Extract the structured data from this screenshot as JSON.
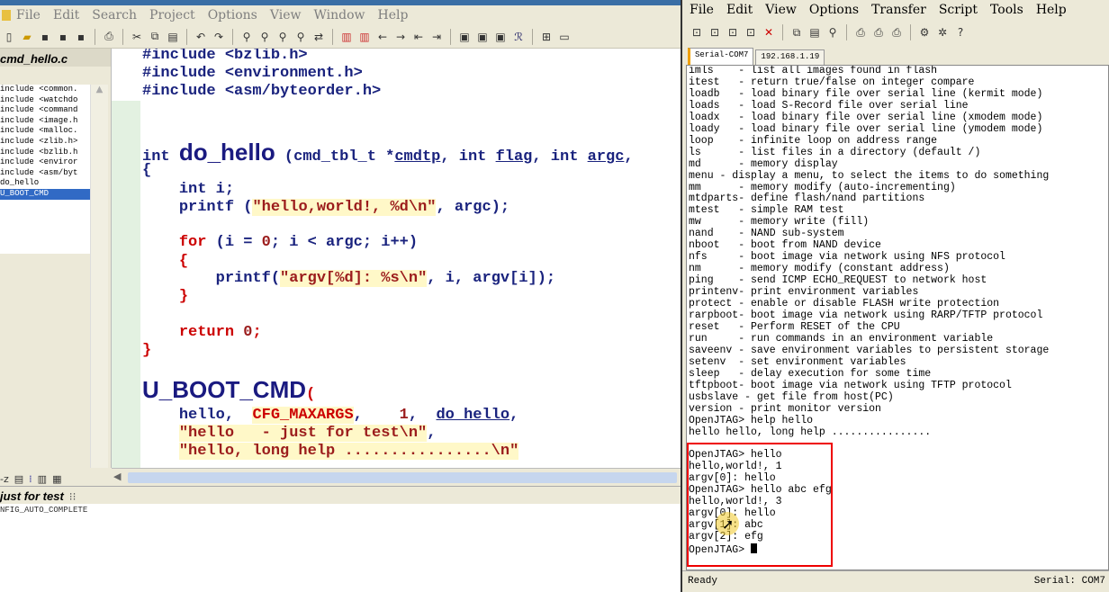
{
  "source_insight": {
    "menu": [
      {
        "label": "File"
      },
      {
        "label": "Edit"
      },
      {
        "label": "Search"
      },
      {
        "label": "Project"
      },
      {
        "label": "Options"
      },
      {
        "label": "View"
      },
      {
        "label": "Window"
      },
      {
        "label": "Help"
      }
    ],
    "file_name": "cmd_hello.c",
    "symbols": [
      "include <common.",
      "include <watchdo",
      "include <command",
      "include <image.h",
      "include <malloc.",
      "include <zlib.h>",
      "include <bzlib.h",
      "include <enviror",
      "include <asm/byt",
      "do_hello",
      "U_BOOT_CMD"
    ],
    "selected_symbol": "U_BOOT_CMD",
    "context_title": "just for test",
    "context_sub": "NFIG_AUTO_COMPLETE",
    "code": {
      "l1": "#include <bzlib.h>",
      "l2": "#include <environment.h>",
      "l3": "#include <asm/byteorder.h>",
      "fn_type": "int",
      "fn_name": "do_hello",
      "fn_params_a": "(cmd_tbl_t *",
      "fn_p1": "cmdtp",
      "fn_params_b": ", int ",
      "fn_p2": "flag",
      "fn_params_c": ", int ",
      "fn_p3": "argc",
      "fn_params_d": ",",
      "open_brace": "{",
      "decl": "int i;",
      "printf1_a": "printf (",
      "printf1_str": "\"hello,world!, %d\\n\"",
      "printf1_b": ", argc);",
      "for_kw": "for",
      "for_rest_a": " (i = ",
      "for_zero": "0",
      "for_rest_b": "; i < argc; i++)",
      "inner_open": "{",
      "printf2_a": "printf(",
      "printf2_str": "\"argv[%d]: %s\\n\"",
      "printf2_b": ", i, argv[i]);",
      "inner_close": "}",
      "return_kw": "return",
      "return_val": "0",
      "return_semi": ";",
      "close_brace": "}",
      "macro_name": "U_BOOT_CMD",
      "macro_paren": "(",
      "m1_a": "hello,",
      "m1_const": "CFG_MAXARGS",
      "m1_b": ",",
      "m1_num": "1",
      "m1_c": ",",
      "m1_fn": "do_hello",
      "m1_d": ",",
      "m2_str": "\"hello   - just for test\\n\"",
      "m2_end": ",",
      "m3_str": "\"hello, long help ................\\n\""
    }
  },
  "securecrt": {
    "menu": [
      {
        "label": "File"
      },
      {
        "label": "Edit"
      },
      {
        "label": "View"
      },
      {
        "label": "Options"
      },
      {
        "label": "Transfer"
      },
      {
        "label": "Script"
      },
      {
        "label": "Tools"
      },
      {
        "label": "Help"
      }
    ],
    "tabs": [
      {
        "label": "Serial-COM7",
        "active": true
      },
      {
        "label": "192.168.1.19",
        "active": false
      }
    ],
    "terminal_lines": [
      "imls    - list all images found in flash",
      "itest   - return true/false on integer compare",
      "loadb   - load binary file over serial line (kermit mode)",
      "loads   - load S-Record file over serial line",
      "loadx   - load binary file over serial line (xmodem mode)",
      "loady   - load binary file over serial line (ymodem mode)",
      "loop    - infinite loop on address range",
      "ls      - list files in a directory (default /)",
      "md      - memory display",
      "menu - display a menu, to select the items to do something",
      "mm      - memory modify (auto-incrementing)",
      "mtdparts- define flash/nand partitions",
      "mtest   - simple RAM test",
      "mw      - memory write (fill)",
      "nand    - NAND sub-system",
      "nboot   - boot from NAND device",
      "nfs     - boot image via network using NFS protocol",
      "nm      - memory modify (constant address)",
      "ping    - send ICMP ECHO_REQUEST to network host",
      "printenv- print environment variables",
      "protect - enable or disable FLASH write protection",
      "rarpboot- boot image via network using RARP/TFTP protocol",
      "reset   - Perform RESET of the CPU",
      "run     - run commands in an environment variable",
      "saveenv - save environment variables to persistent storage",
      "setenv  - set environment variables",
      "sleep   - delay execution for some time",
      "tftpboot- boot image via network using TFTP protocol",
      "usbslave - get file from host(PC)",
      "version - print monitor version",
      "OpenJTAG> help hello",
      "hello hello, long help ................",
      "",
      "OpenJTAG> hello",
      "hello,world!, 1",
      "argv[0]: hello",
      "OpenJTAG> hello abc efg",
      "hello,world!, 3",
      "argv[0]: hello",
      "argv[1]: abc",
      "argv[2]: efg",
      "OpenJTAG> "
    ],
    "status_left": "Ready",
    "status_right": "Serial: COM7"
  }
}
